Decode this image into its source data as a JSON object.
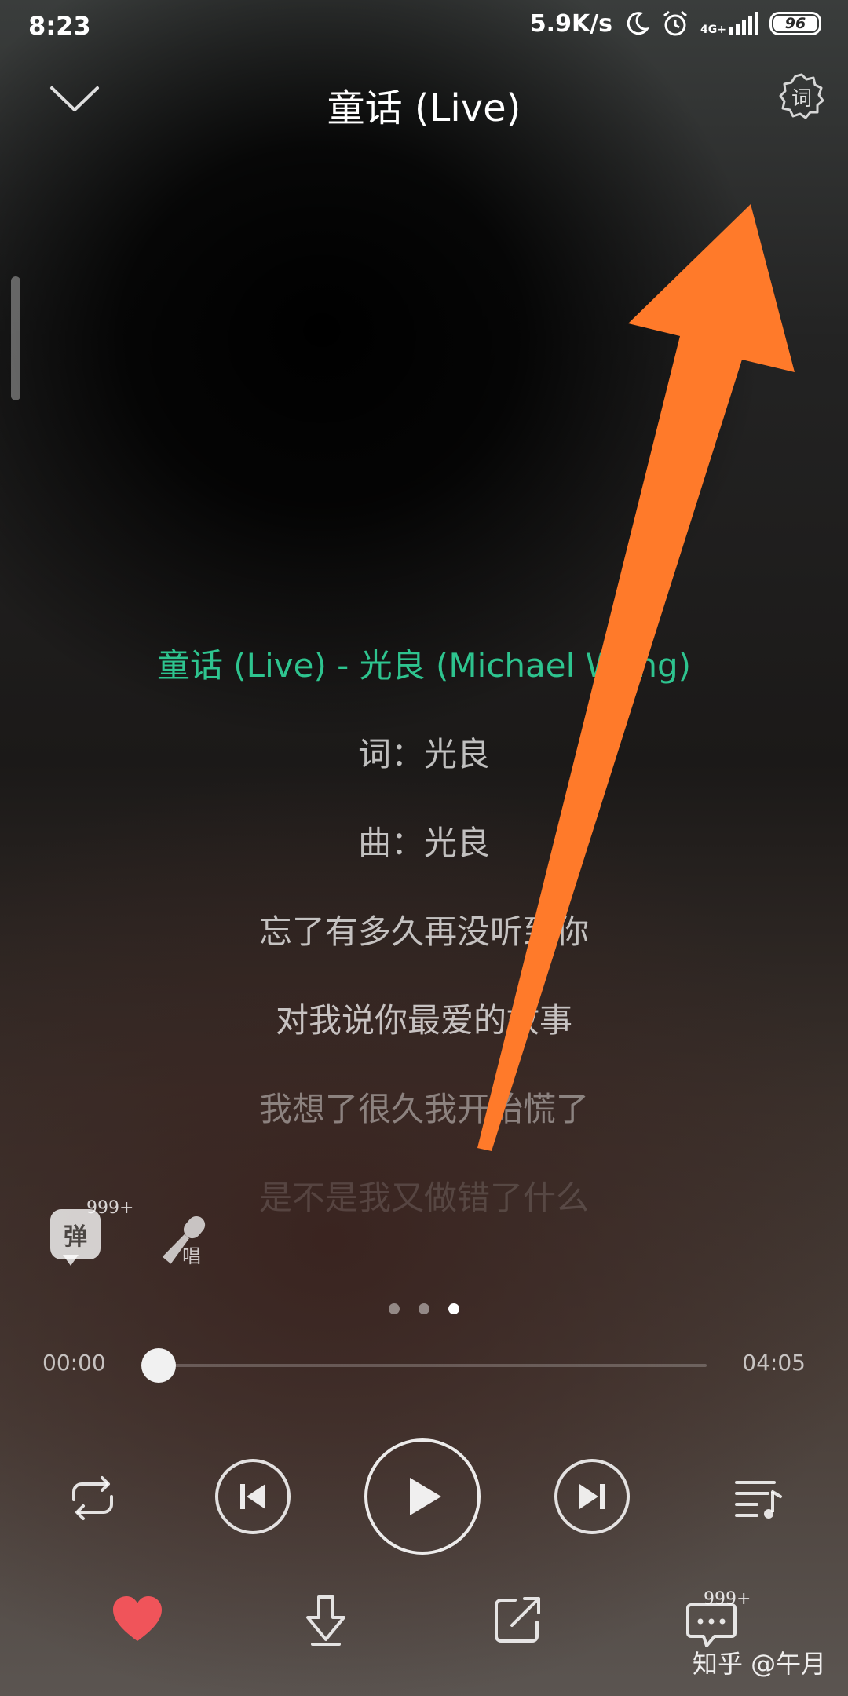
{
  "status_bar": {
    "time": "8:23",
    "net_speed": "5.9K/s",
    "network_type": "4G+",
    "battery": "96",
    "icons": [
      "moon-icon",
      "alarm-icon",
      "signal-icon",
      "battery-icon"
    ]
  },
  "header": {
    "title": "童话 (Live)",
    "lyric_settings_label": "词"
  },
  "lyrics": {
    "lines": [
      "童话 (Live) - 光良 (Michael Wong)",
      "词：光良",
      "曲：光良",
      "忘了有多久再没听到你",
      "对我说你最爱的故事",
      "我想了很久我开始慌了",
      "是不是我又做错了什么"
    ],
    "active_index": 0
  },
  "actions": {
    "danmu_label": "弹",
    "danmu_count": "999+",
    "sing_label": "唱"
  },
  "pager": {
    "count": 3,
    "active": 2
  },
  "player": {
    "current_time": "00:00",
    "total_time": "04:05",
    "progress": 0
  },
  "bottom": {
    "comment_count": "999+",
    "watermark": "知乎 @午月"
  },
  "colors": {
    "accent": "#2ec48f",
    "like": "#f0545a",
    "annotation_arrow": "#ff7a2a"
  }
}
